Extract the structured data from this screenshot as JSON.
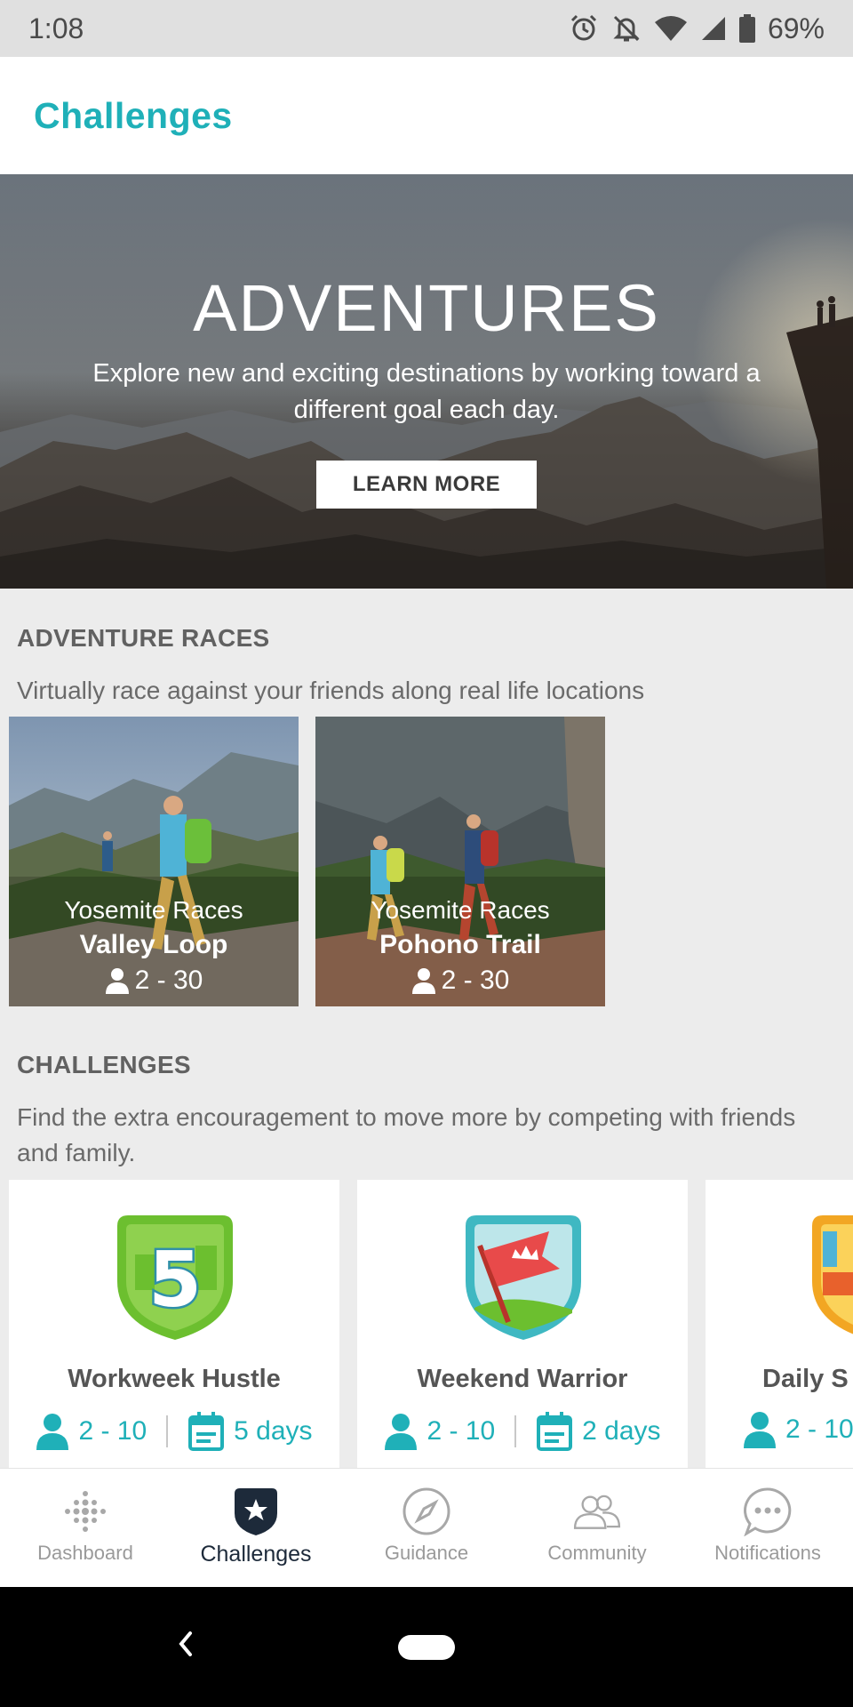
{
  "status_bar": {
    "time": "1:08",
    "battery": "69%",
    "icons": [
      "alarm-icon",
      "bell-off-icon",
      "wifi-icon",
      "signal-icon",
      "battery-icon"
    ]
  },
  "header": {
    "title": "Challenges"
  },
  "hero": {
    "title": "ADVENTURES",
    "description": "Explore new and exciting destinations by working toward a different goal each day.",
    "button_label": "LEARN MORE"
  },
  "adventure_races": {
    "heading": "ADVENTURE RACES",
    "subtitle": "Virtually race against your friends along real life locations",
    "cards": [
      {
        "series": "Yosemite Races",
        "name": "Valley Loop",
        "players": "2 - 30"
      },
      {
        "series": "Yosemite Races",
        "name": "Pohono Trail",
        "players": "2 - 30"
      }
    ]
  },
  "challenges": {
    "heading": "CHALLENGES",
    "subtitle": "Find the extra encouragement to move more by competing with friends and family.",
    "cards": [
      {
        "name": "Workweek Hustle",
        "players": "2 - 10",
        "duration": "5 days",
        "badge": "five-badge-icon"
      },
      {
        "name": "Weekend Warrior",
        "players": "2 - 10",
        "duration": "2 days",
        "badge": "flag-badge-icon"
      },
      {
        "name": "Daily S",
        "players": "2 - 10",
        "duration": "",
        "badge": "shoe-badge-icon"
      }
    ]
  },
  "bottom_nav": {
    "items": [
      {
        "label": "Dashboard",
        "icon": "dots-grid-icon",
        "active": false
      },
      {
        "label": "Challenges",
        "icon": "star-shield-icon",
        "active": true
      },
      {
        "label": "Guidance",
        "icon": "compass-icon",
        "active": false
      },
      {
        "label": "Community",
        "icon": "people-icon",
        "active": false
      },
      {
        "label": "Notifications",
        "icon": "chat-dots-icon",
        "active": false
      }
    ]
  },
  "colors": {
    "accent": "#1fb0b8",
    "active_nav": "#1d2a3a",
    "background": "#ececec"
  }
}
